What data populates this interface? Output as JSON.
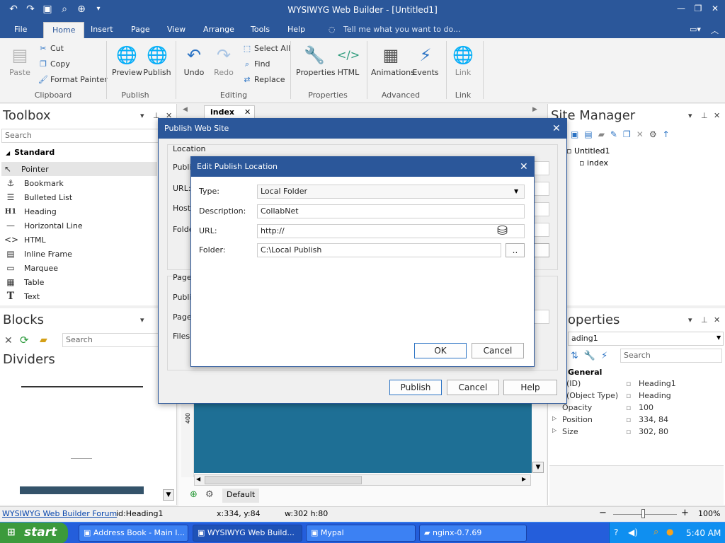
{
  "window": {
    "title": "WYSIWYG Web Builder - [Untitled1]"
  },
  "menu_tabs": [
    "File",
    "Home",
    "Insert",
    "Page",
    "View",
    "Arrange",
    "Tools",
    "Help"
  ],
  "tell_me": "Tell me what you want to do...",
  "ribbon": {
    "clipboard": {
      "paste": "Paste",
      "cut": "Cut",
      "copy": "Copy",
      "format_painter": "Format Painter",
      "label": "Clipboard"
    },
    "publish": {
      "preview": "Preview",
      "publish": "Publish",
      "label": "Publish"
    },
    "editing": {
      "undo": "Undo",
      "redo": "Redo",
      "select_all": "Select All",
      "find": "Find",
      "replace": "Replace",
      "label": "Editing"
    },
    "properties": {
      "properties": "Properties",
      "html": "HTML",
      "label": "Properties"
    },
    "advanced": {
      "animations": "Animations",
      "events": "Events",
      "label": "Advanced"
    },
    "link": {
      "link": "Link",
      "label": "Link"
    }
  },
  "toolbox": {
    "title": "Toolbox",
    "search_placeholder": "Search",
    "category": "Standard",
    "items": [
      "Pointer",
      "Bookmark",
      "Bulleted List",
      "Heading",
      "Horizontal Line",
      "HTML",
      "Inline Frame",
      "Marquee",
      "Table",
      "Text"
    ]
  },
  "blocks": {
    "title": "Blocks",
    "search_placeholder": "Search",
    "category": "Dividers"
  },
  "doc_tab": "index",
  "site_manager": {
    "title": "Site Manager",
    "root": "Untitled1",
    "child": "index"
  },
  "properties_panel": {
    "title": "operties",
    "selected": "ading1",
    "search_placeholder": "Search",
    "category": "General",
    "rows": [
      {
        "name": "(ID)",
        "value": "Heading1"
      },
      {
        "name": "(Object Type)",
        "value": "Heading"
      },
      {
        "name": "Opacity",
        "value": "100"
      },
      {
        "name": "Position",
        "value": "334, 84"
      },
      {
        "name": "Size",
        "value": "302, 80"
      }
    ]
  },
  "publish_dialog": {
    "title": "Publish Web Site",
    "location_group": "Location",
    "labels": [
      "Publi",
      "URL:",
      "Host:",
      "Folde"
    ],
    "page_group": "Page",
    "page_labels": [
      "Publi",
      "Page",
      "Files:"
    ],
    "publish_btn": "Publish",
    "cancel_btn": "Cancel",
    "help_btn": "Help"
  },
  "edit_dialog": {
    "title": "Edit Publish Location",
    "type_label": "Type:",
    "type_value": "Local Folder",
    "description_label": "Description:",
    "description_value": "CollabNet",
    "url_label": "URL:",
    "url_value": "http://",
    "folder_label": "Folder:",
    "folder_value": "C:\\Local Publish",
    "browse": "..",
    "ok": "OK",
    "cancel": "Cancel"
  },
  "canvas": {
    "ruler_mark": "400",
    "default_label": "Default"
  },
  "statusbar": {
    "forum_link": "WYSIWYG Web Builder Forum",
    "id": "id:Heading1",
    "xy": "x:334, y:84",
    "wh": "w:302 h:80",
    "zoom": "100%"
  },
  "taskbar": {
    "start": "start",
    "buttons": [
      "Address Book - Main I...",
      "WYSIWYG Web Build...",
      "Mypal",
      "nginx-0.7.69"
    ],
    "time": "5:40 AM"
  },
  "colors": {
    "accent": "#2b579a",
    "canvas": "#1e6f95"
  }
}
